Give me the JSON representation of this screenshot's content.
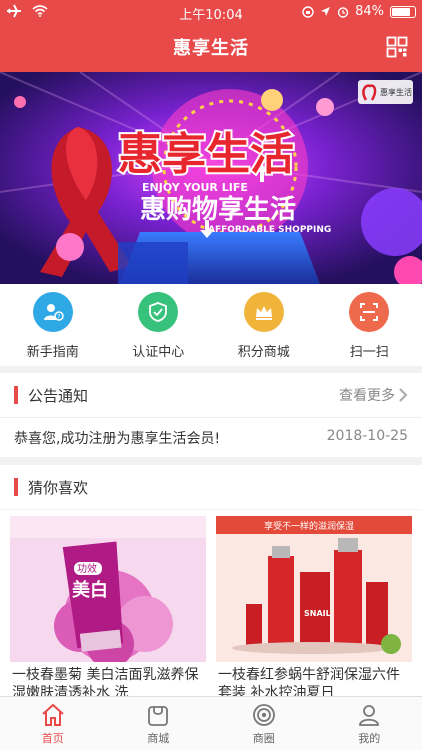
{
  "status_bar": {
    "time": "上午10:04",
    "battery": "84%",
    "battery_level": 0.84
  },
  "nav": {
    "title": "惠享生活",
    "qr_icon": "qr-scan-icon"
  },
  "banner": {
    "title": "惠享生活",
    "subtitle_en_top": "ENJOY YOUR LIFE",
    "subtitle_cn": "惠购物享生活",
    "subtitle_en_bottom": "AFFORDABLE SHOPPING",
    "logo_text": "惠享生活"
  },
  "quick_links": [
    {
      "label": "新手指南",
      "icon": "newbie-guide-icon",
      "color": "#2fa8e6"
    },
    {
      "label": "认证中心",
      "icon": "verified-shield-icon",
      "color": "#36c27a"
    },
    {
      "label": "积分商城",
      "icon": "crown-icon",
      "color": "#f0b43a"
    },
    {
      "label": "扫一扫",
      "icon": "scan-icon",
      "color": "#ef6a4d"
    }
  ],
  "notice": {
    "title": "公告通知",
    "more": "查看更多",
    "text": "恭喜您,成功注册为惠享生活会员!",
    "date": "2018-10-25"
  },
  "recommend": {
    "title": "猜你喜欢"
  },
  "products": [
    {
      "name": "一枝春墨菊 美白洁面乳滋养保湿嫩肤清透补水 洗",
      "img_badge": "功效",
      "img_title": "美白"
    },
    {
      "name": "一枝春红参蜗牛舒润保湿六件套装 补水控油夏日",
      "img_banner": "享受不一样的滋润保湿",
      "img_brand": "SNAIL"
    }
  ],
  "tabs": [
    {
      "label": "首页",
      "icon": "home-icon",
      "active": true
    },
    {
      "label": "商城",
      "icon": "shopping-bag-icon",
      "active": false
    },
    {
      "label": "商圈",
      "icon": "target-circle-icon",
      "active": false
    },
    {
      "label": "我的",
      "icon": "user-icon",
      "active": false
    }
  ],
  "colors": {
    "brand": "#e84a4a",
    "active_tab": "#e84a4a"
  }
}
